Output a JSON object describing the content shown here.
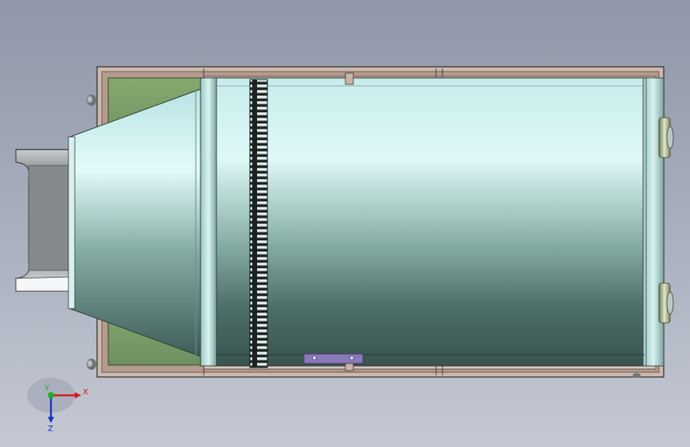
{
  "viewport": {
    "background_top": "#8f97a8",
    "background_bottom": "#c4c9d3"
  },
  "model": {
    "frame_color": "#b59b8e",
    "panel_color": "#7fa36a",
    "drum_highlight": "#dcf6f6",
    "drum_shadow": "#3f5a55",
    "gear_color": "#1d2726",
    "bracket_color": "#8a7ab8"
  },
  "triad": {
    "x_label": "X",
    "y_label": "Y",
    "z_label": "Z",
    "x_color": "#d21e1e",
    "y_color": "#1fae2d",
    "z_color": "#1e35c8"
  }
}
